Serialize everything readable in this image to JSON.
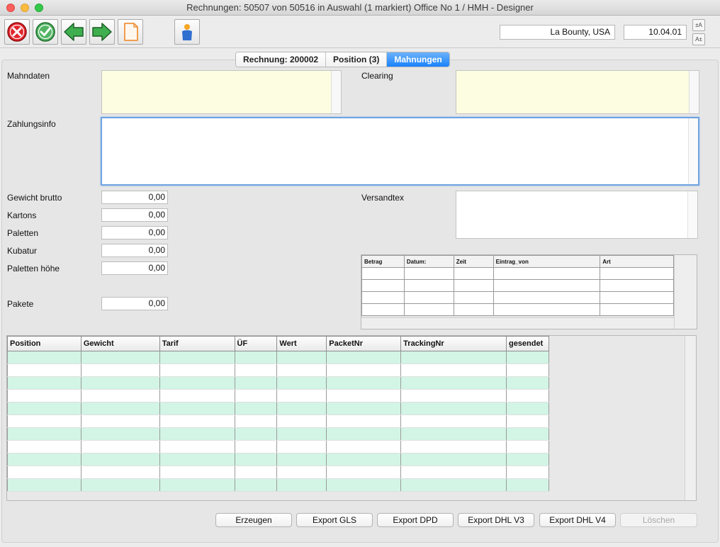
{
  "window": {
    "title": "Rechnungen: 50507 von 50516 in Auswahl  (1 markiert) Office No 1 /  HMH - Designer"
  },
  "toolbar": {
    "customer": "La Bounty, USA",
    "date": "10.04.01",
    "font_up": "±A",
    "font_down": "A±",
    "icons": [
      "cancel-icon",
      "accept-icon",
      "previous-icon",
      "next-icon",
      "document-icon",
      "user-icon"
    ]
  },
  "tabs": [
    {
      "label": "Rechnung:  200002",
      "active": false
    },
    {
      "label": "Position (3)",
      "active": false
    },
    {
      "label": "Mahnungen",
      "active": true
    }
  ],
  "form": {
    "mahndaten_label": "Mahndaten",
    "clearing_label": "Clearing",
    "zahlungsinfo_label": "Zahlungsinfo",
    "versandtex_label": "Versandtex",
    "fields": [
      {
        "label": "Gewicht brutto",
        "value": "0,00"
      },
      {
        "label": "Kartons",
        "value": "0,00"
      },
      {
        "label": "Paletten",
        "value": "0,00"
      },
      {
        "label": "Kubatur",
        "value": "0,00"
      },
      {
        "label": "Paletten höhe",
        "value": "0,00"
      }
    ],
    "pakete": {
      "label": "Pakete",
      "value": "0,00"
    }
  },
  "payments_table": {
    "columns": [
      "Betrag",
      "Datum:",
      "Zeit",
      "Eintrag_von",
      "Art"
    ]
  },
  "packages_table": {
    "columns": [
      "Position",
      "Gewicht",
      "Tarif",
      "ÜF",
      "Wert",
      "PacketNr",
      "TrackingNr",
      "gesendet"
    ]
  },
  "buttons": {
    "erzeugen": "Erzeugen",
    "export_gls": "Export GLS",
    "export_dpd": "Export DPD",
    "export_dhl_v3": "Export DHL V3",
    "export_dhl_v4": "Export DHL V4",
    "loeschen": "Löschen"
  },
  "colors": {
    "row_alt": "#d2f5e6",
    "field_yellow": "#fdfde1",
    "tab_active": "#1a82fb"
  }
}
